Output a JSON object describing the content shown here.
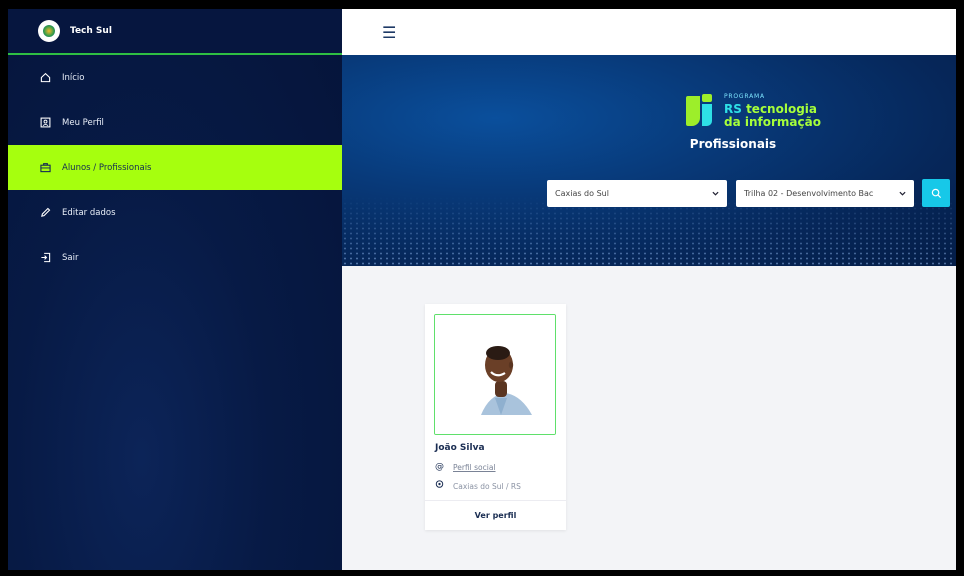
{
  "sidebar": {
    "brand": "Tech Sul",
    "items": [
      {
        "label": "Início",
        "icon": "home-icon",
        "active": false
      },
      {
        "label": "Meu Perfil",
        "icon": "profile-icon",
        "active": false
      },
      {
        "label": "Alunos / Profissionais",
        "icon": "briefcase-icon",
        "active": true
      },
      {
        "label": "Editar dados",
        "icon": "pencil-icon",
        "active": false
      },
      {
        "label": "Sair",
        "icon": "logout-icon",
        "active": false
      }
    ]
  },
  "topbar": {
    "menu_icon": "hamburger-icon"
  },
  "hero": {
    "brand_small": "PROGRAMA",
    "brand_rs": "RS",
    "brand_line1": " tecnologia",
    "brand_line2": "da informação",
    "title": "Profissionais",
    "city_select": "Caxias do Sul",
    "track_select": "Trilha 02 - Desenvolvimento Bac",
    "search_icon": "search-icon"
  },
  "card": {
    "name": "João Silva",
    "social_label": "Perfil social",
    "location": "Caxias do Sul / RS",
    "button": "Ver perfil"
  },
  "colors": {
    "sidebar_bg": "#071a45",
    "active_bg": "#a6ff0e",
    "accent_green": "#2fbf43",
    "search_btn": "#17c8e8",
    "hero_bg": "#083a7a"
  }
}
